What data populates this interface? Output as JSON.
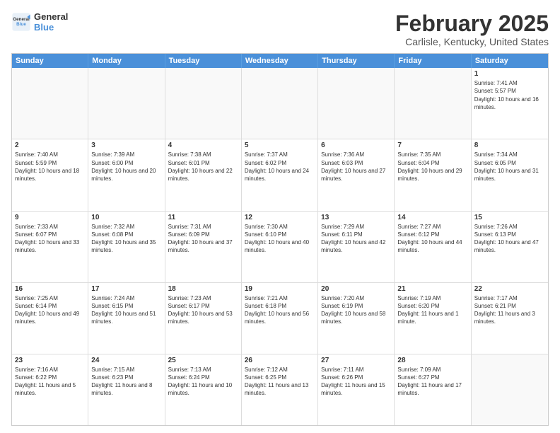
{
  "logo": {
    "line1": "General",
    "line2": "Blue"
  },
  "title": "February 2025",
  "subtitle": "Carlisle, Kentucky, United States",
  "days_of_week": [
    "Sunday",
    "Monday",
    "Tuesday",
    "Wednesday",
    "Thursday",
    "Friday",
    "Saturday"
  ],
  "weeks": [
    [
      {
        "day": "",
        "info": ""
      },
      {
        "day": "",
        "info": ""
      },
      {
        "day": "",
        "info": ""
      },
      {
        "day": "",
        "info": ""
      },
      {
        "day": "",
        "info": ""
      },
      {
        "day": "",
        "info": ""
      },
      {
        "day": "1",
        "info": "Sunrise: 7:41 AM\nSunset: 5:57 PM\nDaylight: 10 hours and 16 minutes."
      }
    ],
    [
      {
        "day": "2",
        "info": "Sunrise: 7:40 AM\nSunset: 5:59 PM\nDaylight: 10 hours and 18 minutes."
      },
      {
        "day": "3",
        "info": "Sunrise: 7:39 AM\nSunset: 6:00 PM\nDaylight: 10 hours and 20 minutes."
      },
      {
        "day": "4",
        "info": "Sunrise: 7:38 AM\nSunset: 6:01 PM\nDaylight: 10 hours and 22 minutes."
      },
      {
        "day": "5",
        "info": "Sunrise: 7:37 AM\nSunset: 6:02 PM\nDaylight: 10 hours and 24 minutes."
      },
      {
        "day": "6",
        "info": "Sunrise: 7:36 AM\nSunset: 6:03 PM\nDaylight: 10 hours and 27 minutes."
      },
      {
        "day": "7",
        "info": "Sunrise: 7:35 AM\nSunset: 6:04 PM\nDaylight: 10 hours and 29 minutes."
      },
      {
        "day": "8",
        "info": "Sunrise: 7:34 AM\nSunset: 6:05 PM\nDaylight: 10 hours and 31 minutes."
      }
    ],
    [
      {
        "day": "9",
        "info": "Sunrise: 7:33 AM\nSunset: 6:07 PM\nDaylight: 10 hours and 33 minutes."
      },
      {
        "day": "10",
        "info": "Sunrise: 7:32 AM\nSunset: 6:08 PM\nDaylight: 10 hours and 35 minutes."
      },
      {
        "day": "11",
        "info": "Sunrise: 7:31 AM\nSunset: 6:09 PM\nDaylight: 10 hours and 37 minutes."
      },
      {
        "day": "12",
        "info": "Sunrise: 7:30 AM\nSunset: 6:10 PM\nDaylight: 10 hours and 40 minutes."
      },
      {
        "day": "13",
        "info": "Sunrise: 7:29 AM\nSunset: 6:11 PM\nDaylight: 10 hours and 42 minutes."
      },
      {
        "day": "14",
        "info": "Sunrise: 7:27 AM\nSunset: 6:12 PM\nDaylight: 10 hours and 44 minutes."
      },
      {
        "day": "15",
        "info": "Sunrise: 7:26 AM\nSunset: 6:13 PM\nDaylight: 10 hours and 47 minutes."
      }
    ],
    [
      {
        "day": "16",
        "info": "Sunrise: 7:25 AM\nSunset: 6:14 PM\nDaylight: 10 hours and 49 minutes."
      },
      {
        "day": "17",
        "info": "Sunrise: 7:24 AM\nSunset: 6:15 PM\nDaylight: 10 hours and 51 minutes."
      },
      {
        "day": "18",
        "info": "Sunrise: 7:23 AM\nSunset: 6:17 PM\nDaylight: 10 hours and 53 minutes."
      },
      {
        "day": "19",
        "info": "Sunrise: 7:21 AM\nSunset: 6:18 PM\nDaylight: 10 hours and 56 minutes."
      },
      {
        "day": "20",
        "info": "Sunrise: 7:20 AM\nSunset: 6:19 PM\nDaylight: 10 hours and 58 minutes."
      },
      {
        "day": "21",
        "info": "Sunrise: 7:19 AM\nSunset: 6:20 PM\nDaylight: 11 hours and 1 minute."
      },
      {
        "day": "22",
        "info": "Sunrise: 7:17 AM\nSunset: 6:21 PM\nDaylight: 11 hours and 3 minutes."
      }
    ],
    [
      {
        "day": "23",
        "info": "Sunrise: 7:16 AM\nSunset: 6:22 PM\nDaylight: 11 hours and 5 minutes."
      },
      {
        "day": "24",
        "info": "Sunrise: 7:15 AM\nSunset: 6:23 PM\nDaylight: 11 hours and 8 minutes."
      },
      {
        "day": "25",
        "info": "Sunrise: 7:13 AM\nSunset: 6:24 PM\nDaylight: 11 hours and 10 minutes."
      },
      {
        "day": "26",
        "info": "Sunrise: 7:12 AM\nSunset: 6:25 PM\nDaylight: 11 hours and 13 minutes."
      },
      {
        "day": "27",
        "info": "Sunrise: 7:11 AM\nSunset: 6:26 PM\nDaylight: 11 hours and 15 minutes."
      },
      {
        "day": "28",
        "info": "Sunrise: 7:09 AM\nSunset: 6:27 PM\nDaylight: 11 hours and 17 minutes."
      },
      {
        "day": "",
        "info": ""
      }
    ]
  ]
}
